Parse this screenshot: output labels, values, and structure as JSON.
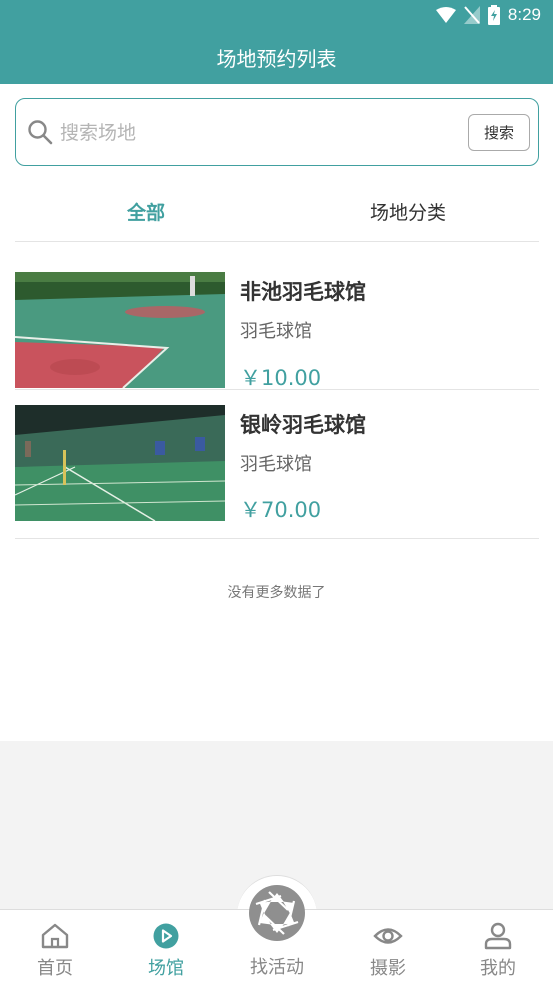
{
  "status_bar": {
    "time": "8:29",
    "icons": [
      "wifi-icon",
      "signal-icon",
      "battery-icon"
    ]
  },
  "header": {
    "title": "场地预约列表"
  },
  "search": {
    "placeholder": "搜索场地",
    "button_label": "搜索"
  },
  "tabs": [
    {
      "label": "全部",
      "active": true
    },
    {
      "label": "场地分类",
      "active": false
    }
  ],
  "venues": [
    {
      "name": "非池羽毛球馆",
      "category": "羽毛球馆",
      "price": "￥10.00"
    },
    {
      "name": "银岭羽毛球馆",
      "category": "羽毛球馆",
      "price": "￥70.00"
    }
  ],
  "list_footer": "没有更多数据了",
  "bottom_nav": [
    {
      "label": "首页",
      "icon": "home-icon",
      "active": false
    },
    {
      "label": "场馆",
      "icon": "venue-play-icon",
      "active": true
    },
    {
      "label": "找活动",
      "icon": "aperture-icon",
      "active": false
    },
    {
      "label": "摄影",
      "icon": "eye-icon",
      "active": false
    },
    {
      "label": "我的",
      "icon": "user-icon",
      "active": false
    }
  ],
  "colors": {
    "accent": "#41a0a0",
    "background": "#f3f3f3"
  }
}
